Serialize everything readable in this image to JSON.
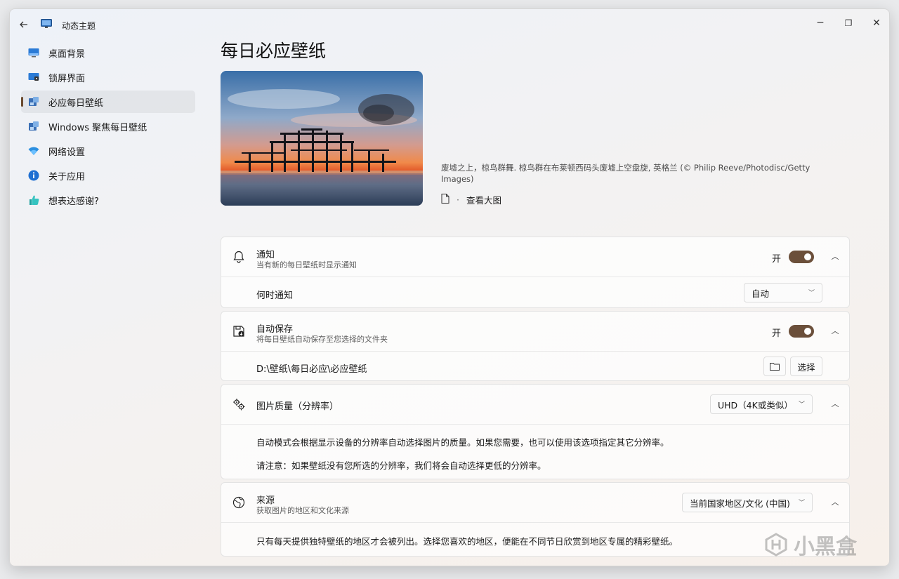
{
  "titlebar": {
    "back_icon": "back-arrow-icon",
    "app_title": "动态主题",
    "minimize": "─",
    "restore": "❐",
    "close": "✕"
  },
  "sidebar": {
    "items": [
      {
        "label": "桌面背景",
        "icon": "desktop-icon"
      },
      {
        "label": "锁屏界面",
        "icon": "lockscreen-icon"
      },
      {
        "label": "必应每日壁纸",
        "icon": "bing-wallpaper-icon"
      },
      {
        "label": "Windows 聚焦每日壁纸",
        "icon": "spotlight-icon"
      },
      {
        "label": "网络设置",
        "icon": "wifi-icon"
      },
      {
        "label": "关于应用",
        "icon": "info-icon"
      },
      {
        "label": "想表达感谢?",
        "icon": "thumbs-up-icon"
      }
    ],
    "active_index": 2
  },
  "main": {
    "page_title": "每日必应壁纸",
    "caption": "废墟之上，椋鸟群舞. 椋鸟群在布莱顿西码头废墟上空盘旋, 英格兰 (© Philip Reeve/Photodisc/Getty Images)",
    "view_large": "查看大图",
    "link_sep": "·"
  },
  "notify": {
    "title": "通知",
    "desc": "当有新的每日壁纸时显示通知",
    "toggle_label": "开",
    "when_label": "何时通知",
    "when_value": "自动"
  },
  "autosave": {
    "title": "自动保存",
    "desc": "将每日壁纸自动保存至您选择的文件夹",
    "toggle_label": "开",
    "path": "D:\\壁纸\\每日必应\\必应壁纸",
    "select_label": "选择"
  },
  "quality": {
    "title": "图片质量（分辨率）",
    "value": "UHD（4K或类似）",
    "para1": "自动模式会根据显示设备的分辨率自动选择图片的质量。如果您需要，也可以使用该选项指定其它分辨率。",
    "para2": "请注意：如果壁纸没有您所选的分辨率，我们将会自动选择更低的分辨率。"
  },
  "source": {
    "title": "来源",
    "desc": "获取图片的地区和文化来源",
    "value": "当前国家地区/文化 (中国)",
    "para": "只有每天提供独特壁纸的地区才会被列出。选择您喜欢的地区，便能在不同节日欣赏到地区专属的精彩壁纸。"
  },
  "watermark": {
    "text": "小黑盒"
  },
  "colors": {
    "accent": "#6b4f3a",
    "active_indicator": "#6b4a2f"
  }
}
